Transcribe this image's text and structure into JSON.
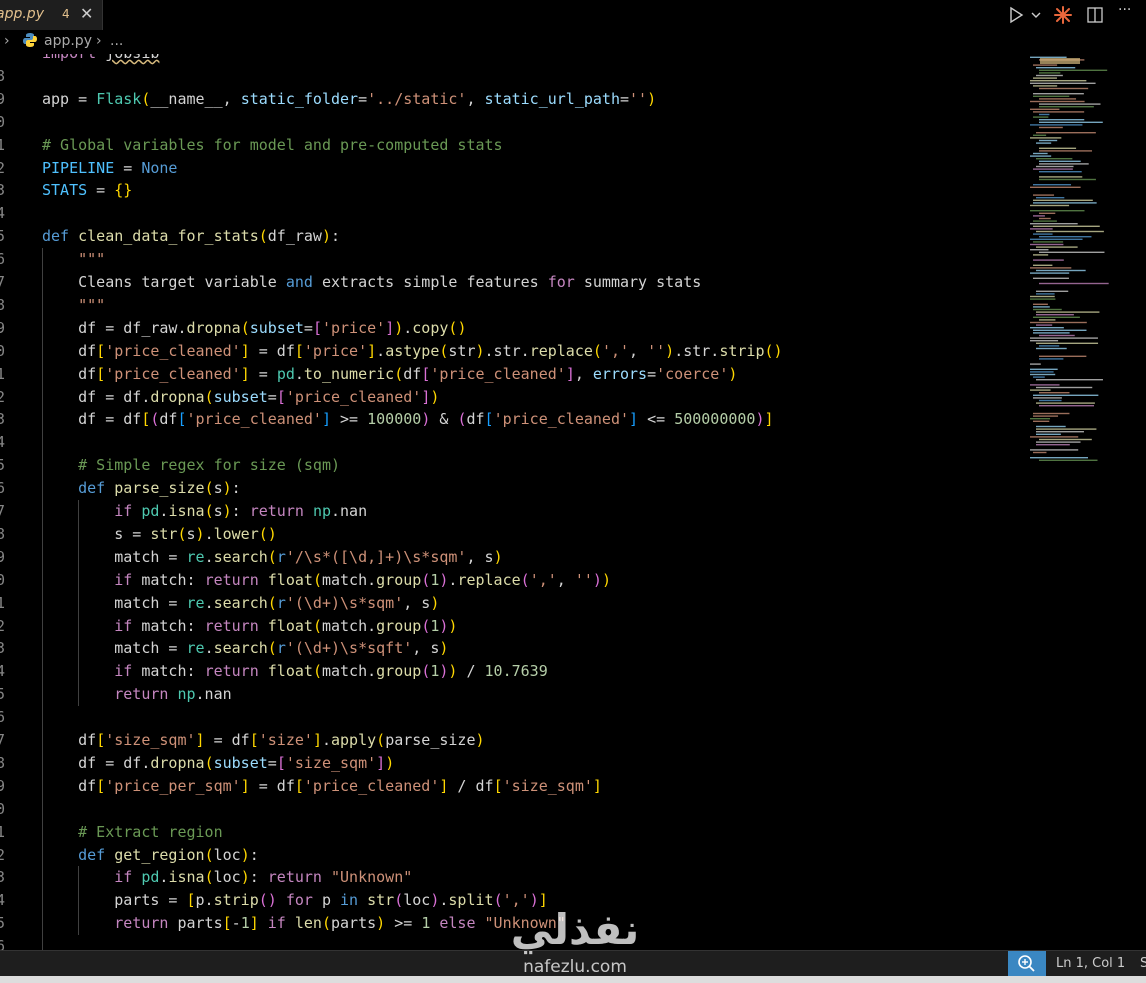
{
  "tab": {
    "filename": "app.py",
    "problems": "4",
    "close": "✕"
  },
  "titlebar": {
    "run_icon": "play-icon",
    "copilot_icon": "spark-icon",
    "split_icon": "split-editor-icon",
    "more": "···"
  },
  "breadcrumb": {
    "file": "app.py",
    "more": "..."
  },
  "editor": {
    "code": [
      {
        "n": "",
        "text": "import jobsib"
      },
      {
        "n": "8",
        "text": ""
      },
      {
        "n": "9",
        "text": "app = Flask(__name__, static_folder='../static', static_url_path='')"
      },
      {
        "n": "0",
        "text": ""
      },
      {
        "n": "1",
        "text": "# Global variables for model and pre-computed stats"
      },
      {
        "n": "2",
        "text": "PIPELINE = None"
      },
      {
        "n": "3",
        "text": "STATS = {}"
      },
      {
        "n": "4",
        "text": ""
      },
      {
        "n": "5",
        "text": "def clean_data_for_stats(df_raw):"
      },
      {
        "n": "6",
        "text": "    \"\"\""
      },
      {
        "n": "7",
        "text": "    Cleans target variable and extracts simple features for summary stats"
      },
      {
        "n": "8",
        "text": "    \"\"\""
      },
      {
        "n": "9",
        "text": "    df = df_raw.dropna(subset=['price']).copy()"
      },
      {
        "n": "0",
        "text": "    df['price_cleaned'] = df['price'].astype(str).str.replace(',', '').str.strip()"
      },
      {
        "n": "1",
        "text": "    df['price_cleaned'] = pd.to_numeric(df['price_cleaned'], errors='coerce')"
      },
      {
        "n": "2",
        "text": "    df = df.dropna(subset=['price_cleaned'])"
      },
      {
        "n": "3",
        "text": "    df = df[(df['price_cleaned'] >= 100000) & (df['price_cleaned'] <= 500000000)]"
      },
      {
        "n": "4",
        "text": ""
      },
      {
        "n": "5",
        "text": "    # Simple regex for size (sqm)"
      },
      {
        "n": "6",
        "text": "    def parse_size(s):"
      },
      {
        "n": "7",
        "text": "        if pd.isna(s): return np.nan"
      },
      {
        "n": "8",
        "text": "        s = str(s).lower()"
      },
      {
        "n": "9",
        "text": "        match = re.search(r'/\\s*([\\d,]+)\\s*sqm', s)"
      },
      {
        "n": "0",
        "text": "        if match: return float(match.group(1).replace(',', ''))"
      },
      {
        "n": "1",
        "text": "        match = re.search(r'(\\d+)\\s*sqm', s)"
      },
      {
        "n": "2",
        "text": "        if match: return float(match.group(1))"
      },
      {
        "n": "3",
        "text": "        match = re.search(r'(\\d+)\\s*sqft', s)"
      },
      {
        "n": "4",
        "text": "        if match: return float(match.group(1)) / 10.7639"
      },
      {
        "n": "5",
        "text": "        return np.nan"
      },
      {
        "n": "6",
        "text": ""
      },
      {
        "n": "7",
        "text": "    df['size_sqm'] = df['size'].apply(parse_size)"
      },
      {
        "n": "8",
        "text": "    df = df.dropna(subset=['size_sqm'])"
      },
      {
        "n": "9",
        "text": "    df['price_per_sqm'] = df['price_cleaned'] / df['size_sqm']"
      },
      {
        "n": "0",
        "text": ""
      },
      {
        "n": "1",
        "text": "    # Extract region"
      },
      {
        "n": "2",
        "text": "    def get_region(loc):"
      },
      {
        "n": "3",
        "text": "        if pd.isna(loc): return \"Unknown\""
      },
      {
        "n": "4",
        "text": "        parts = [p.strip() for p in str(loc).split(',')]"
      },
      {
        "n": "5",
        "text": "        return parts[-1] if len(parts) >= 1 else \"Unknown\""
      },
      {
        "n": "6",
        "text": ""
      }
    ]
  },
  "statusbar": {
    "position": "Ln 1, Col 1",
    "extra": "S",
    "zoom_icon": "zoom-in-icon"
  },
  "watermark": {
    "arabic": "نفذلي",
    "latin": "nafezlu.com"
  }
}
